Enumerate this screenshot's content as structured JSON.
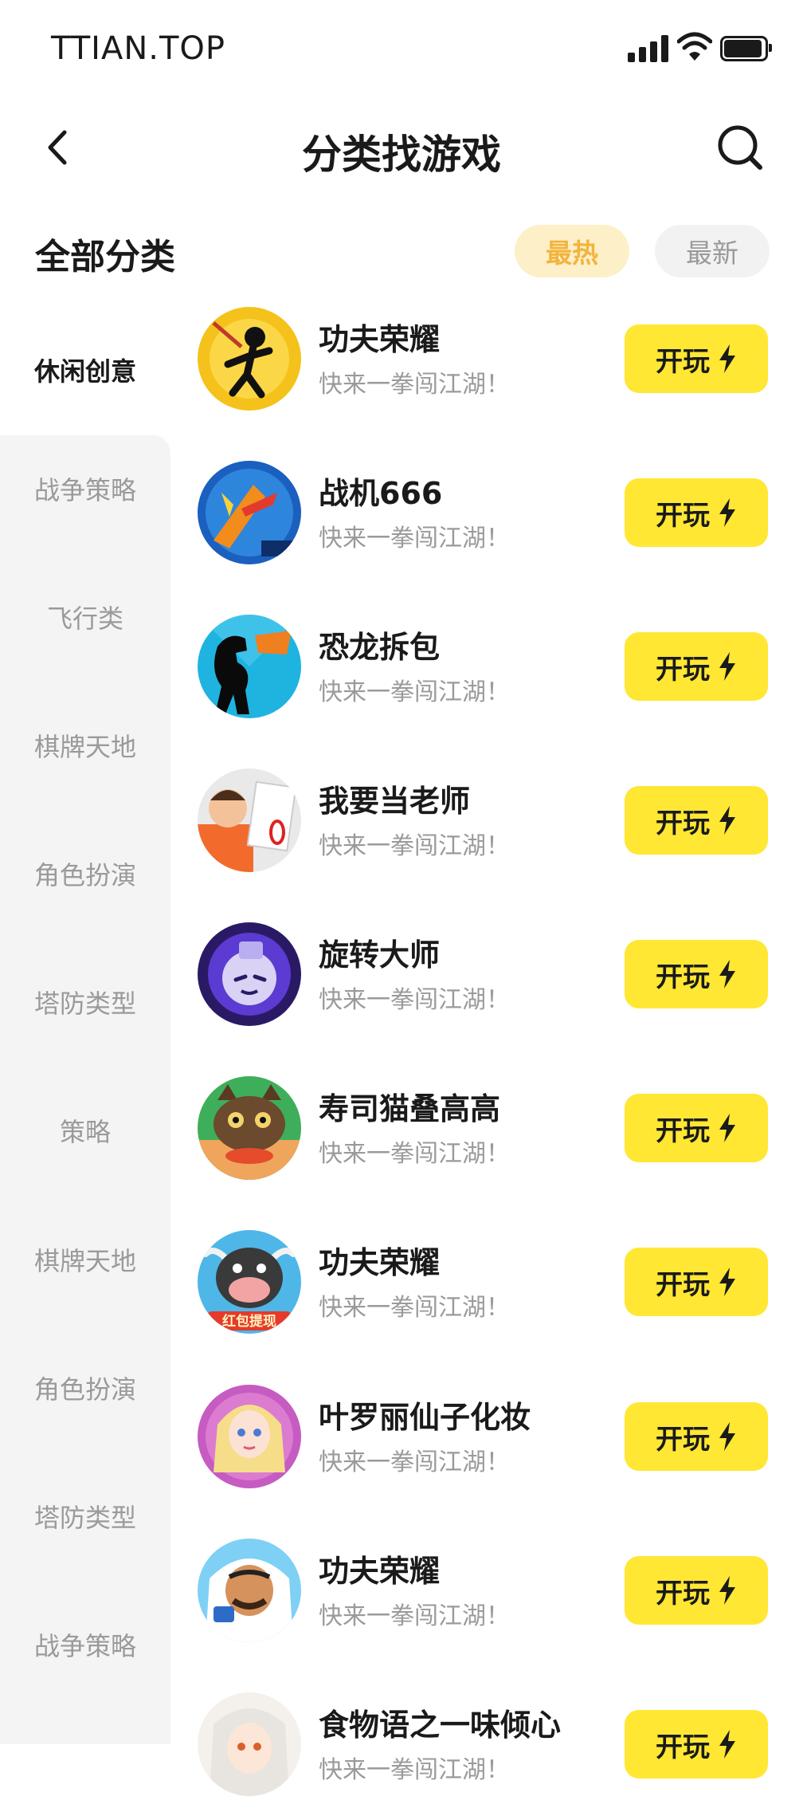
{
  "status_bar": {
    "carrier": "TTIAN.TOP"
  },
  "header": {
    "title": "分类找游戏"
  },
  "category_bar": {
    "all_label": "全部分类",
    "sort_hot": "最热",
    "sort_new": "最新"
  },
  "sidebar": {
    "items": [
      {
        "label": "休闲创意",
        "active": true
      },
      {
        "label": "战争策略"
      },
      {
        "label": "飞行类"
      },
      {
        "label": "棋牌天地"
      },
      {
        "label": "角色扮演"
      },
      {
        "label": "塔防类型"
      },
      {
        "label": "策略"
      },
      {
        "label": "棋牌天地"
      },
      {
        "label": "角色扮演"
      },
      {
        "label": "塔防类型"
      },
      {
        "label": "战争策略"
      }
    ]
  },
  "games": [
    {
      "name": "功夫荣耀",
      "desc": "快来一拳闯江湖！",
      "play_label": "开玩"
    },
    {
      "name": "战机666",
      "desc": "快来一拳闯江湖！",
      "play_label": "开玩"
    },
    {
      "name": "恐龙拆包",
      "desc": "快来一拳闯江湖！",
      "play_label": "开玩"
    },
    {
      "name": "我要当老师",
      "desc": "快来一拳闯江湖！",
      "play_label": "开玩"
    },
    {
      "name": "旋转大师",
      "desc": "快来一拳闯江湖！",
      "play_label": "开玩"
    },
    {
      "name": "寿司猫叠高高",
      "desc": "快来一拳闯江湖！",
      "play_label": "开玩"
    },
    {
      "name": "功夫荣耀",
      "desc": "快来一拳闯江湖！",
      "play_label": "开玩",
      "icon_text": "红包提现"
    },
    {
      "name": "叶罗丽仙子化妆",
      "desc": "快来一拳闯江湖！",
      "play_label": "开玩"
    },
    {
      "name": "功夫荣耀",
      "desc": "快来一拳闯江湖！",
      "play_label": "开玩"
    },
    {
      "name": "食物语之一味倾心",
      "desc": "快来一拳闯江湖！",
      "play_label": "开玩"
    }
  ],
  "colors": {
    "accent_yellow": "#ffe733",
    "hot_bg": "#fdefc8",
    "hot_text": "#f2b43c",
    "sidebar_bg": "#f4f4f4"
  }
}
